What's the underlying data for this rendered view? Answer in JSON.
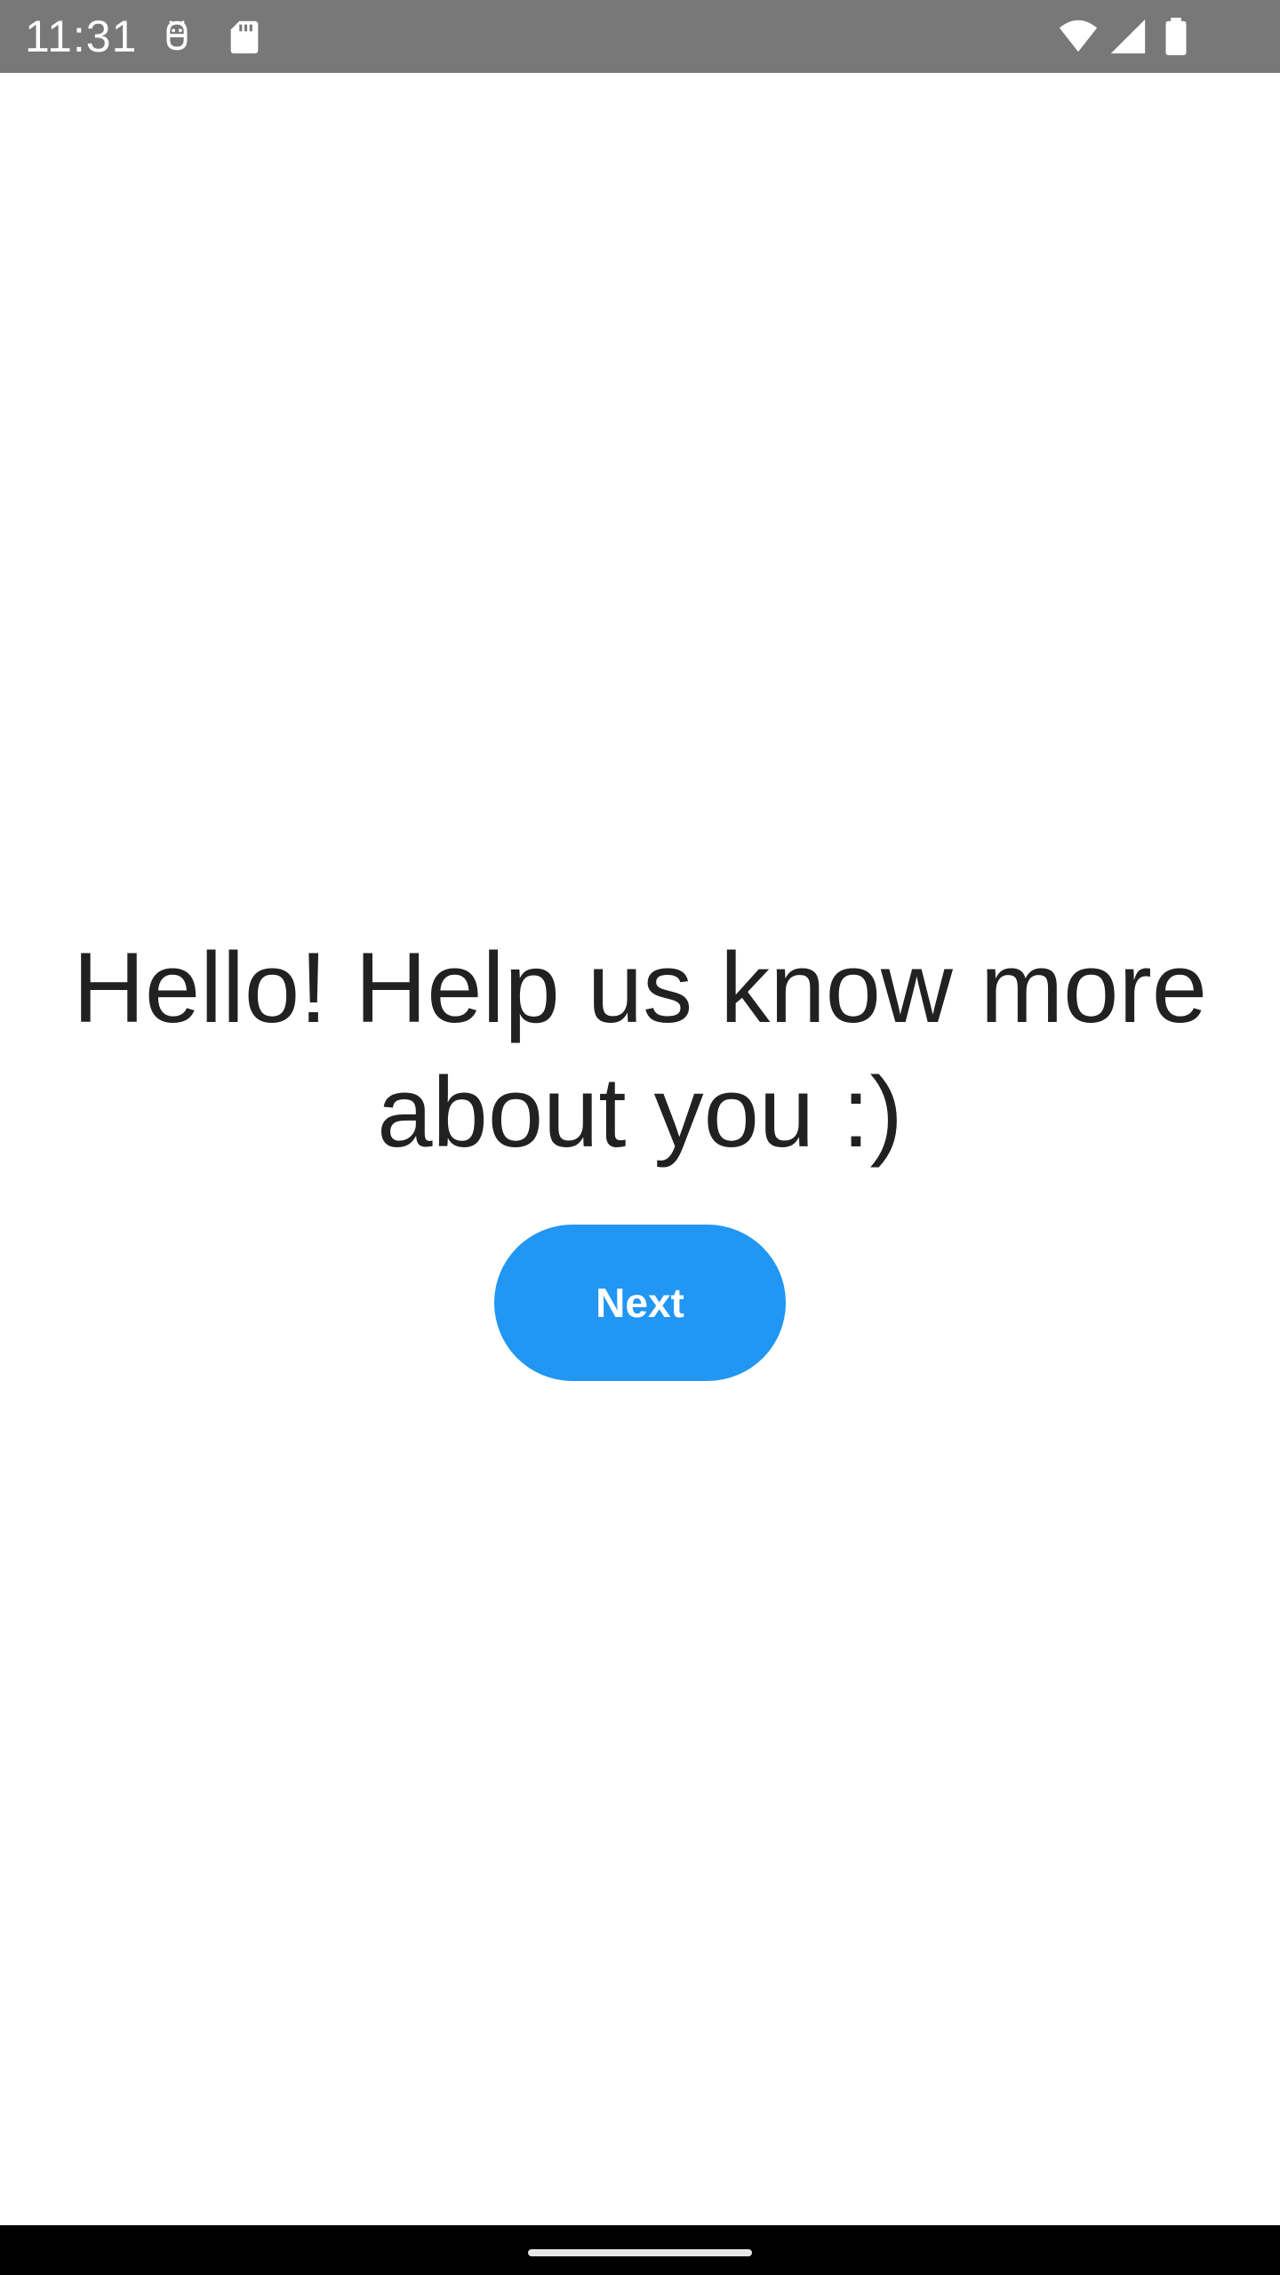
{
  "status_bar": {
    "time": "11:31",
    "background_color": "#787878",
    "icons": [
      "android-debug-icon",
      "sd-card-icon",
      "wifi-icon",
      "cellular-signal-icon",
      "battery-icon"
    ]
  },
  "main": {
    "headline": "Hello! Help us know more about you :)",
    "next_button_label": "Next",
    "accent_color": "#2196F3"
  },
  "nav_bar": {
    "handle": "home-gesture-handle"
  }
}
